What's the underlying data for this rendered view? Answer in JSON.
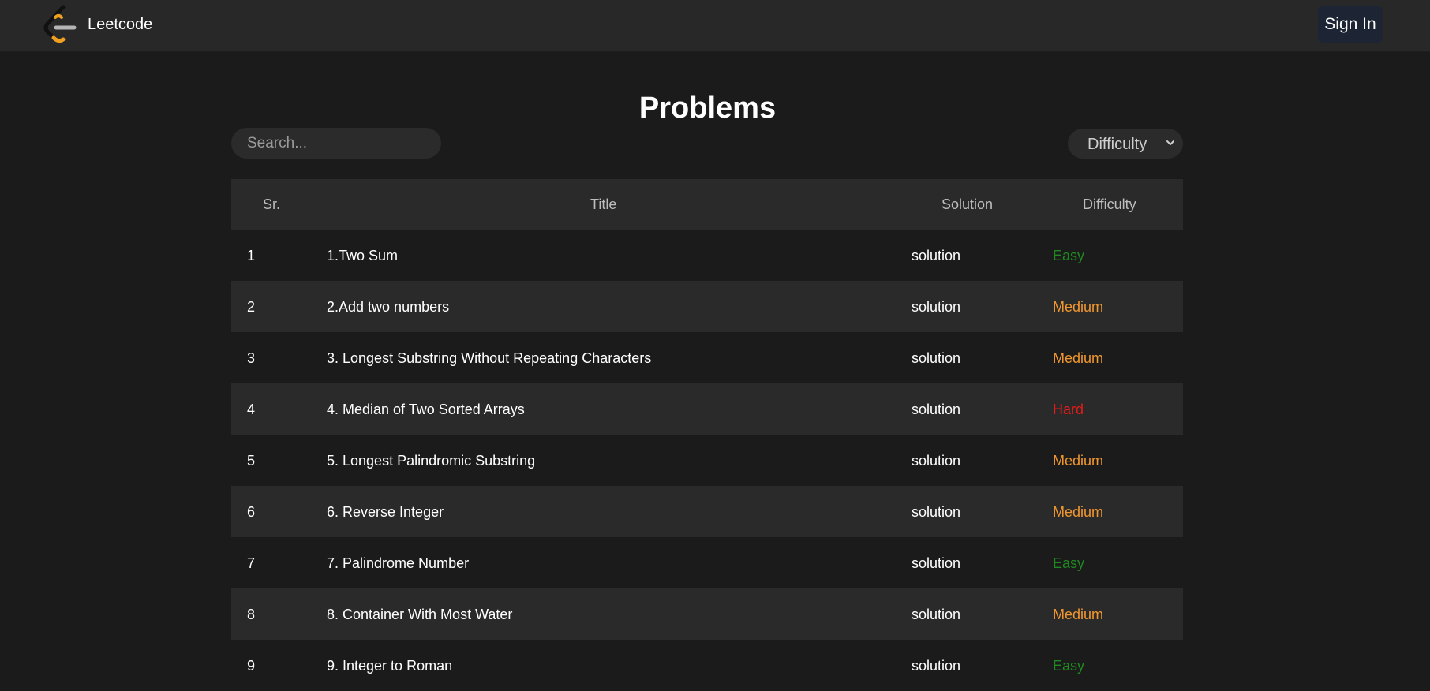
{
  "navbar": {
    "brand": "Leetcode",
    "sign_in_label": "Sign In"
  },
  "main": {
    "title": "Problems",
    "search_placeholder": "Search...",
    "difficulty_filter": "Difficulty"
  },
  "table": {
    "headers": {
      "sr": "Sr.",
      "title": "Title",
      "solution": "Solution",
      "difficulty": "Difficulty"
    },
    "rows": [
      {
        "sr": "1",
        "title": "1.Two Sum",
        "solution": "solution",
        "difficulty": "Easy"
      },
      {
        "sr": "2",
        "title": "2.Add two numbers",
        "solution": "solution",
        "difficulty": "Medium"
      },
      {
        "sr": "3",
        "title": "3. Longest Substring Without Repeating Characters",
        "solution": "solution",
        "difficulty": "Medium"
      },
      {
        "sr": "4",
        "title": "4. Median of Two Sorted Arrays",
        "solution": "solution",
        "difficulty": "Hard"
      },
      {
        "sr": "5",
        "title": "5. Longest Palindromic Substring",
        "solution": "solution",
        "difficulty": "Medium"
      },
      {
        "sr": "6",
        "title": "6. Reverse Integer",
        "solution": "solution",
        "difficulty": "Medium"
      },
      {
        "sr": "7",
        "title": "7. Palindrome Number",
        "solution": "solution",
        "difficulty": "Easy"
      },
      {
        "sr": "8",
        "title": "8. Container With Most Water",
        "solution": "solution",
        "difficulty": "Medium"
      },
      {
        "sr": "9",
        "title": "9. Integer to Roman",
        "solution": "solution",
        "difficulty": "Easy"
      }
    ]
  },
  "colors": {
    "easy": "#1f8a1f",
    "medium": "#f0972f",
    "hard": "#e51a1a",
    "logo_orange": "#f0a020"
  }
}
